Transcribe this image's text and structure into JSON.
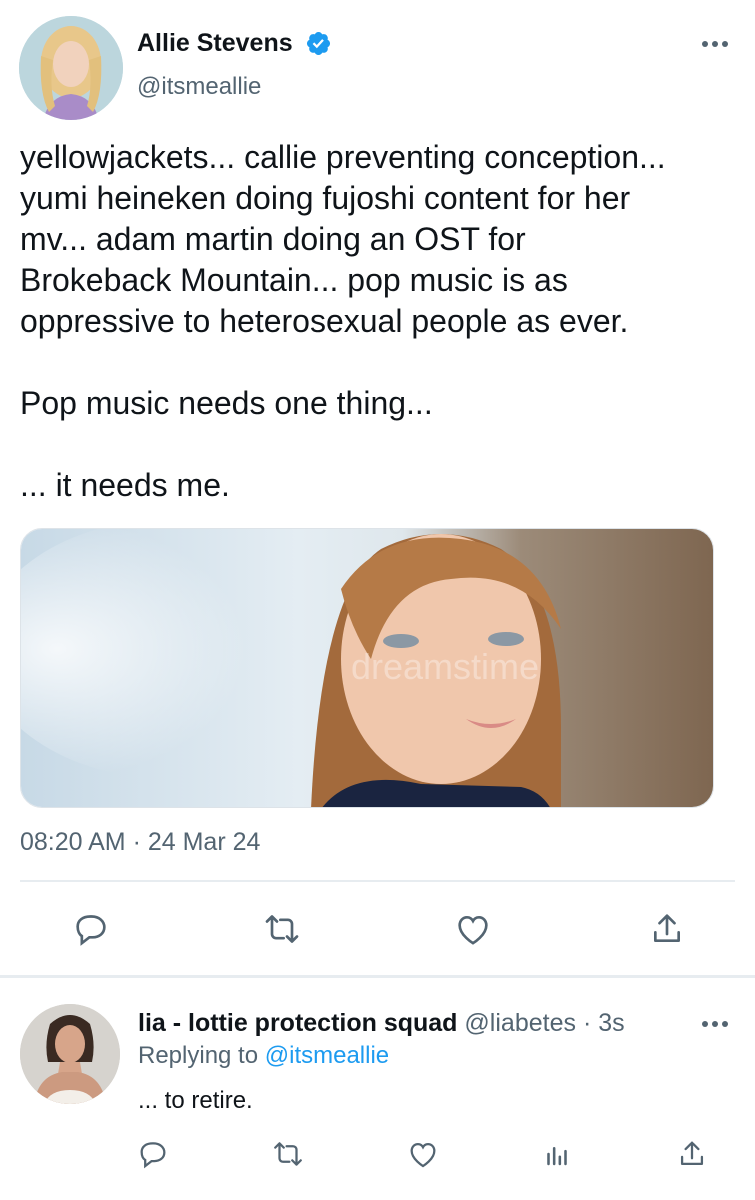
{
  "tweet": {
    "author_name": "Allie Stevens",
    "author_handle": "@itsmeallie",
    "verified": true,
    "body_lines": [
      "yellowjackets... callie preventing conception...",
      "yumi heineken doing fujoshi content for her",
      "mv... adam martin doing an OST for",
      "Brokeback Mountain... pop music is as",
      "oppressive to heterosexual people as ever."
    ],
    "body_line_2": "Pop music needs one thing...",
    "body_line_3": "... it needs me.",
    "media_watermark": "dreamstime",
    "timestamp": "08:20 AM · 24 Mar 24",
    "actions": [
      "reply-icon",
      "retweet-icon",
      "like-icon",
      "share-icon"
    ],
    "more_icon": "more-options-icon"
  },
  "reply": {
    "author_name": "lia - lottie protection squad",
    "author_handle": "@liabetes",
    "separator": "·",
    "time_ago": "3s",
    "replying_prefix": "Replying to",
    "replying_to": "@itsmeallie",
    "text": "... to retire.",
    "actions": [
      "reply-icon",
      "retweet-icon",
      "like-icon",
      "analytics-icon",
      "share-icon"
    ]
  },
  "colors": {
    "text_primary": "#0f1419",
    "text_secondary": "#536471",
    "accent": "#1d9bf0",
    "divider": "#e7ecf0"
  }
}
